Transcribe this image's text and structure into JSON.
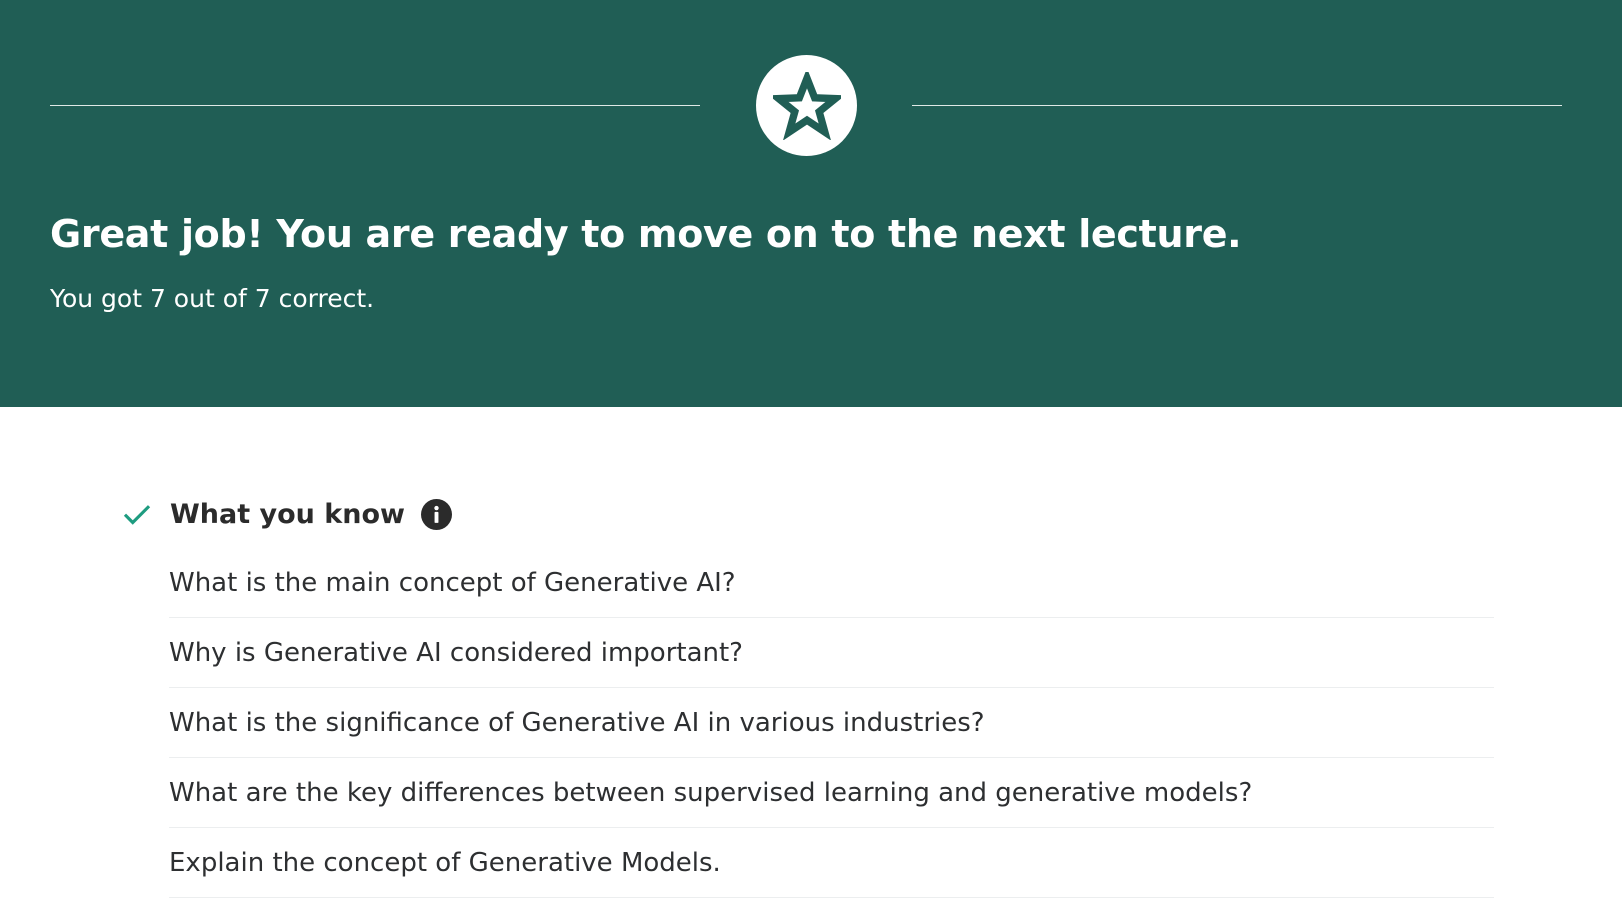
{
  "banner": {
    "headline": "Great job! You are ready to move on to the next lecture.",
    "score_text": "You got 7 out of 7 correct.",
    "icon": "star-icon",
    "background_color": "#205e55"
  },
  "knowledge_section": {
    "title": "What you know",
    "status_icon": "check-icon",
    "info_icon": "info-icon",
    "accent_color": "#1e9c80",
    "questions": [
      "What is the main concept of Generative AI?",
      "Why is Generative AI considered important?",
      "What is the significance of Generative AI in various industries?",
      "What are the key differences between supervised learning and generative models?",
      "Explain the concept of Generative Models."
    ]
  }
}
